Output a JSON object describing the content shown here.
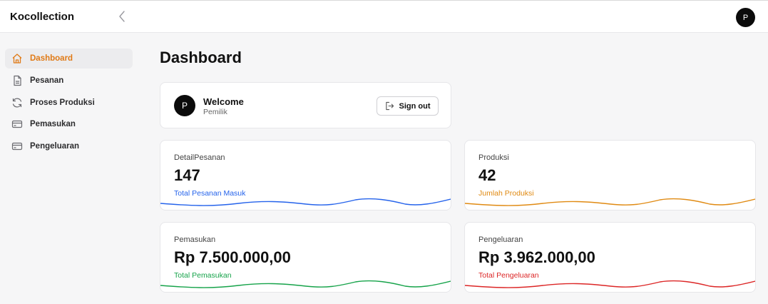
{
  "header": {
    "brand": "Kocollection",
    "avatar_initial": "P"
  },
  "sidebar": {
    "items": [
      {
        "label": "Dashboard",
        "icon": "home-icon",
        "active": true
      },
      {
        "label": "Pesanan",
        "icon": "document-icon",
        "active": false
      },
      {
        "label": "Proses Produksi",
        "icon": "refresh-icon",
        "active": false
      },
      {
        "label": "Pemasukan",
        "icon": "credit-card-icon",
        "active": false
      },
      {
        "label": "Pengeluaran",
        "icon": "credit-card-icon",
        "active": false
      }
    ]
  },
  "main": {
    "title": "Dashboard",
    "welcome": {
      "avatar_initial": "P",
      "title": "Welcome",
      "subtitle": "Pemilik",
      "signout_label": "Sign out"
    },
    "stats": [
      {
        "label": "DetailPesanan",
        "value": "147",
        "caption": "Total Pesanan Masuk",
        "color": "#2563eb"
      },
      {
        "label": "Produksi",
        "value": "42",
        "caption": "Jumlah Produksi",
        "color": "#e08a12"
      },
      {
        "label": "Pemasukan",
        "value": "Rp 7.500.000,00",
        "caption": "Total Pemasukan",
        "color": "#16a34a"
      },
      {
        "label": "Pengeluaran",
        "value": "Rp 3.962.000,00",
        "caption": "Total Pengeluaran",
        "color": "#dc2626"
      }
    ]
  },
  "colors": {
    "accent": "#e07a16",
    "active_bg": "#ececee"
  }
}
